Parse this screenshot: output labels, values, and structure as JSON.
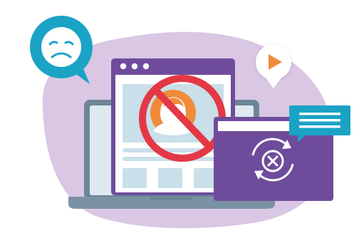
{
  "illustration": {
    "subject": "blocked-profile-sync-error",
    "colors": {
      "blob": "#d9c7e4",
      "purple": "#6f4c9b",
      "purple_dark": "#5b3a87",
      "laptop_body": "#6d8598",
      "laptop_base": "#7b92a4",
      "screen_bezel": "#dfe9f1",
      "panel": "#c9dfe9",
      "panel_light": "#e3eef5",
      "teal": "#1aa3c5",
      "teal_dark": "#0f87a8",
      "orange": "#f08b3b",
      "prohibit_red": "#e43846",
      "white": "#ffffff"
    },
    "icons": [
      "sad-face-speech-bubble-icon",
      "play-button-bubble-icon",
      "profile-avatar-icon",
      "prohibited-sign-icon",
      "sync-error-icon",
      "chat-message-icon"
    ]
  }
}
